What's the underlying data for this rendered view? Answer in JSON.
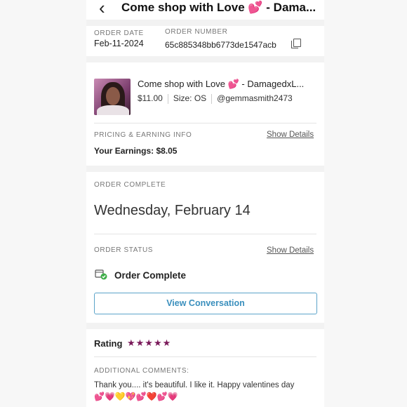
{
  "header": {
    "back_icon": "chevron-left-icon",
    "title": "Come shop with Love 💕 - Dama..."
  },
  "order_info": {
    "date_label": "ORDER DATE",
    "date_value": "Feb-11-2024",
    "number_label": "ORDER NUMBER",
    "number_value": "65c885348bb6773de1547acb",
    "copy_icon": "copy-icon"
  },
  "item": {
    "title": "Come shop with Love 💕 - DamagedxL...",
    "price": "$11.00",
    "size": "Size: OS",
    "seller": "@gemmasmith2473"
  },
  "pricing": {
    "label": "PRICING & EARNING INFO",
    "show_details": "Show Details",
    "earnings": "Your Earnings: $8.05"
  },
  "order_complete": {
    "label": "ORDER COMPLETE",
    "date": "Wednesday, February 14"
  },
  "order_status": {
    "label": "ORDER STATUS",
    "show_details": "Show Details",
    "status": "Order Complete",
    "status_icon": "package-check-icon",
    "accent": "#3fae49"
  },
  "conversation": {
    "button": "View Conversation",
    "color": "#3a8fbd"
  },
  "rating": {
    "label": "Rating",
    "stars": "★★★★★",
    "star_color": "#7a1a5a"
  },
  "comments": {
    "label": "ADDITIONAL COMMENTS:",
    "text": "Thank you.... it's beautiful. I like it. Happy valentines day",
    "emojis": "💕💗💛💖💕❤️💕💗"
  }
}
